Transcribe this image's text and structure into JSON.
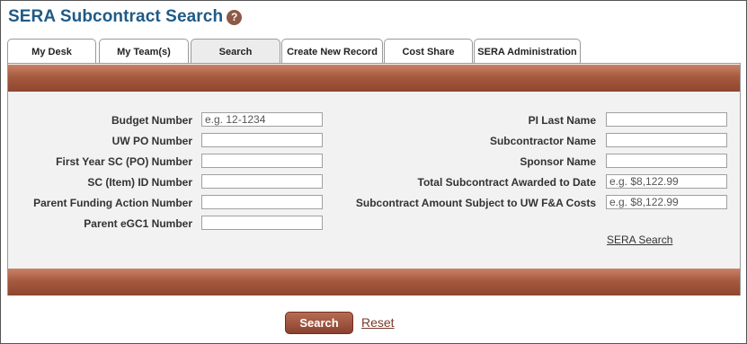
{
  "page": {
    "title": "SERA Subcontract Search",
    "help_icon": "?"
  },
  "tabs": [
    {
      "label": "My Desk",
      "active": false
    },
    {
      "label": "My Team(s)",
      "active": false
    },
    {
      "label": "Search",
      "active": true
    },
    {
      "label": "Create New Record",
      "active": false
    },
    {
      "label": "Cost Share",
      "active": false
    },
    {
      "label": "SERA Administration",
      "active": false
    }
  ],
  "form": {
    "left": [
      {
        "label": "Budget Number",
        "value": "",
        "placeholder": "e.g. 12-1234"
      },
      {
        "label": "UW PO Number",
        "value": "",
        "placeholder": ""
      },
      {
        "label": "First Year SC (PO) Number",
        "value": "",
        "placeholder": ""
      },
      {
        "label": "SC (Item) ID Number",
        "value": "",
        "placeholder": ""
      },
      {
        "label": "Parent Funding Action Number",
        "value": "",
        "placeholder": ""
      },
      {
        "label": "Parent eGC1 Number",
        "value": "",
        "placeholder": ""
      }
    ],
    "right": [
      {
        "label": "PI Last Name",
        "value": "",
        "placeholder": ""
      },
      {
        "label": "Subcontractor Name",
        "value": "",
        "placeholder": ""
      },
      {
        "label": "Sponsor Name",
        "value": "",
        "placeholder": ""
      },
      {
        "label": "Total Subcontract Awarded to Date",
        "value": "",
        "placeholder": "e.g. $8,122.99"
      },
      {
        "label": "Subcontract Amount Subject to UW F&A Costs",
        "value": "",
        "placeholder": "e.g. $8,122.99"
      }
    ],
    "sera_search_link": "SERA Search"
  },
  "actions": {
    "search_label": "Search",
    "reset_label": "Reset"
  },
  "colors": {
    "title": "#1f5a86",
    "band": "#a65a3f",
    "button": "#8a4130"
  }
}
